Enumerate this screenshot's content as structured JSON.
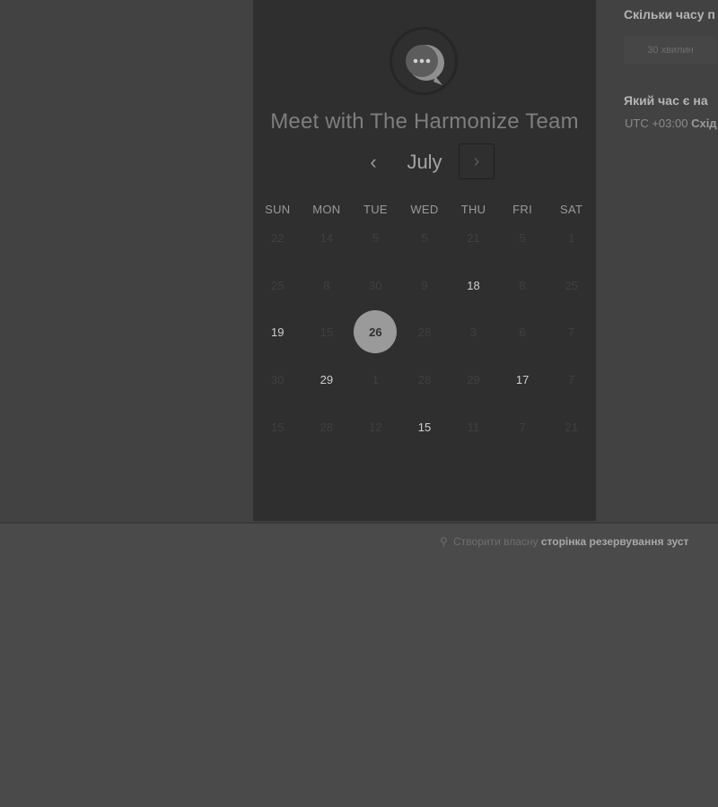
{
  "header": {
    "title": "Meet with The Harmonize Team"
  },
  "calendar": {
    "month": "July",
    "prev_icon": "chevron-left-icon",
    "next_icon": "chevron-right-icon",
    "weekdays": [
      "SUN",
      "MON",
      "TUE",
      "WED",
      "THU",
      "FRI",
      "SAT"
    ],
    "weeks": [
      [
        {
          "d": "22",
          "s": "n"
        },
        {
          "d": "14",
          "s": "n"
        },
        {
          "d": "5",
          "s": "n"
        },
        {
          "d": "5",
          "s": "n"
        },
        {
          "d": "21",
          "s": "n"
        },
        {
          "d": "5",
          "s": "n"
        },
        {
          "d": "1",
          "s": "n"
        }
      ],
      [
        {
          "d": "25",
          "s": "n"
        },
        {
          "d": "8",
          "s": "n"
        },
        {
          "d": "30",
          "s": "n"
        },
        {
          "d": "9",
          "s": "n"
        },
        {
          "d": "18",
          "s": "a"
        },
        {
          "d": "8",
          "s": "n"
        },
        {
          "d": "25",
          "s": "n"
        }
      ],
      [
        {
          "d": "19",
          "s": "a"
        },
        {
          "d": "15",
          "s": "n"
        },
        {
          "d": "26",
          "s": "sel"
        },
        {
          "d": "28",
          "s": "n"
        },
        {
          "d": "3",
          "s": "n"
        },
        {
          "d": "6",
          "s": "n"
        },
        {
          "d": "7",
          "s": "n"
        }
      ],
      [
        {
          "d": "30",
          "s": "n"
        },
        {
          "d": "29",
          "s": "a"
        },
        {
          "d": "1",
          "s": "n"
        },
        {
          "d": "28",
          "s": "n"
        },
        {
          "d": "29",
          "s": "n"
        },
        {
          "d": "17",
          "s": "a"
        },
        {
          "d": "7",
          "s": "n"
        }
      ],
      [
        {
          "d": "15",
          "s": "n"
        },
        {
          "d": "28",
          "s": "n"
        },
        {
          "d": "12",
          "s": "n"
        },
        {
          "d": "15",
          "s": "a"
        },
        {
          "d": "11",
          "s": "n"
        },
        {
          "d": "7",
          "s": "n"
        },
        {
          "d": "21",
          "s": "n"
        }
      ]
    ]
  },
  "details": {
    "duration_label": "Скільки часу п",
    "duration_option": "30 хвилин",
    "time_label": "Який час є на",
    "timezone_offset": "UTC +03:00",
    "timezone_name": "Схід"
  },
  "footer": {
    "prefix": "Створити власну",
    "link": "сторінка резервування зуст",
    "icon": "hubspot-sprocket-icon"
  },
  "colors": {
    "panel": "#2f2f2f",
    "page": "#424242",
    "selected_day": "#9a9a9a"
  }
}
